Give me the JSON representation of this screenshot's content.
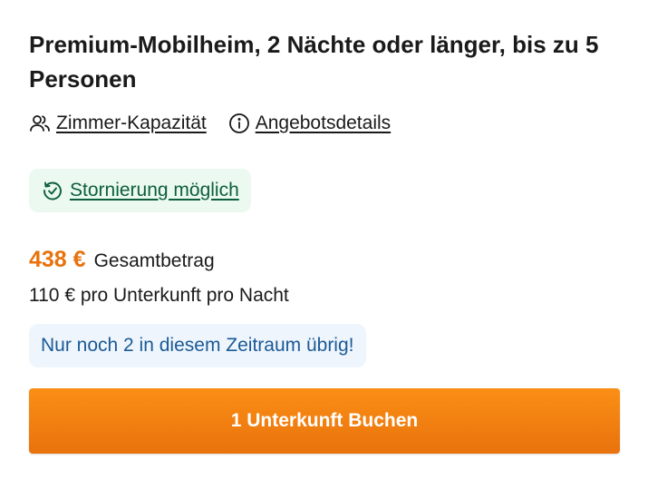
{
  "offer": {
    "title": "Premium-Mobilheim, 2 Nächte oder länger, bis zu 5 Personen",
    "links": [
      {
        "label": "Zimmer-Kapazität",
        "icon": "people-icon"
      },
      {
        "label": "Angebotsdetails",
        "icon": "info-icon"
      }
    ],
    "cancellation": {
      "label": "Stornierung möglich",
      "icon": "clock-check-icon"
    },
    "price": {
      "total": "438 €",
      "total_label": "Gesamtbetrag",
      "per_night": "110 € pro Unterkunft pro Nacht"
    },
    "availability_notice": "Nur noch 2 in diesem Zeitraum übrig!",
    "book_button_label": "1 Unterkunft Buchen"
  },
  "colors": {
    "price": "#e8720c",
    "button": "#f5820f",
    "cancellation_bg": "#ebf9f0",
    "cancellation_text": "#0d5f3a",
    "notice_bg": "#eef5fc",
    "notice_text": "#1b5a96"
  }
}
